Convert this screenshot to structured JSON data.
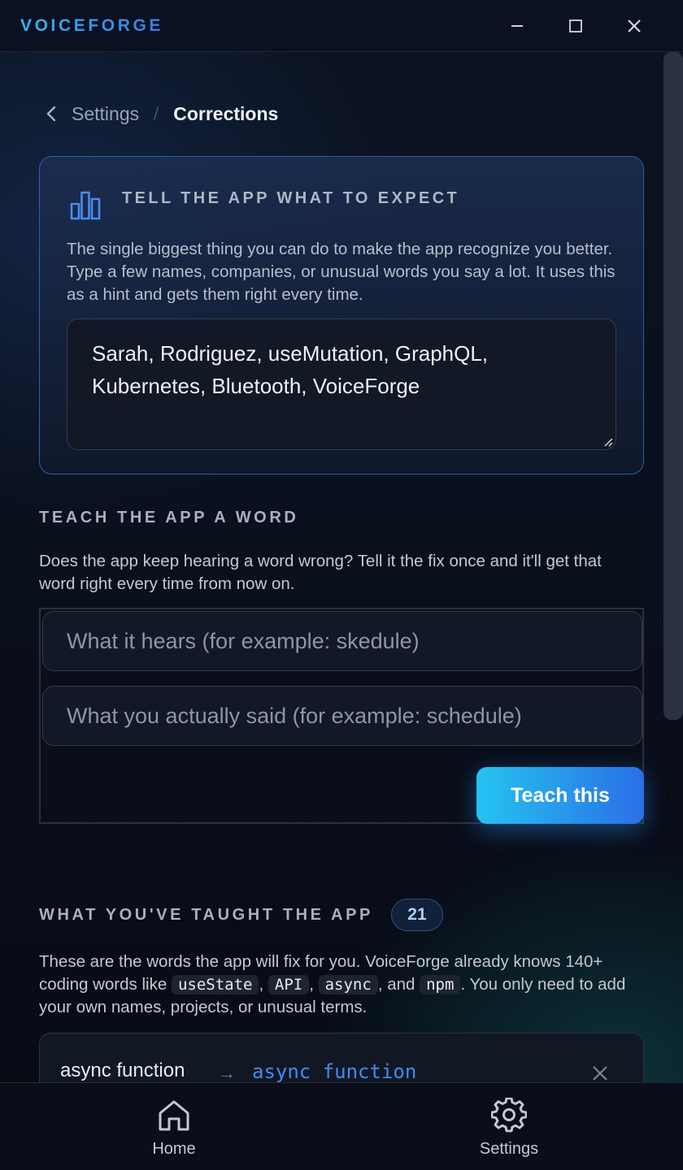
{
  "app": {
    "title": "VOICEFORGE"
  },
  "window_controls": {
    "minimize_icon": "minimize-icon",
    "maximize_icon": "maximize-icon",
    "close_icon": "close-icon"
  },
  "breadcrumb": {
    "back_icon": "chevron-left-icon",
    "parent": "Settings",
    "separator": "/",
    "current": "Corrections"
  },
  "expect_card": {
    "icon": "bar-chart-icon",
    "title": "TELL THE APP WHAT TO EXPECT",
    "description": "The single biggest thing you can do to make the app recognize you better. Type a few names, companies, or unusual words you say a lot. It uses this as a hint and gets them right every time.",
    "hints_value": "Sarah, Rodriguez, useMutation, GraphQL, Kubernetes, Bluetooth, VoiceForge"
  },
  "teach_section": {
    "title": "TEACH THE APP A WORD",
    "description": "Does the app keep hearing a word wrong? Tell it the fix once and it'll get that word right every time from now on.",
    "heard_placeholder": "What it hears (for example: skedule)",
    "heard_value": "",
    "actual_placeholder": "What you actually said (for example: schedule)",
    "actual_value": "",
    "button_label": "Teach this"
  },
  "taught_section": {
    "title": "WHAT YOU'VE TAUGHT THE APP",
    "count": "21",
    "desc_part1": "These are the words the app will fix for you. VoiceForge already knows 140+ coding words like ",
    "chip_1": "useState",
    "sep_1": ", ",
    "chip_2": "API",
    "sep_2": ", ",
    "chip_3": "async",
    "sep_3": ", and ",
    "chip_4": "npm",
    "desc_part2": ". You only need to add your own names, projects, or unusual terms.",
    "rules": [
      {
        "from": "async function",
        "arrow": "→",
        "to": "async function"
      }
    ]
  },
  "bottom_nav": {
    "home_label": "Home",
    "settings_label": "Settings"
  },
  "colors": {
    "accent_start": "#25c3f0",
    "accent_end": "#2a6fe6",
    "card_border": "#2b5fa8",
    "background": "#0a0f1c"
  }
}
